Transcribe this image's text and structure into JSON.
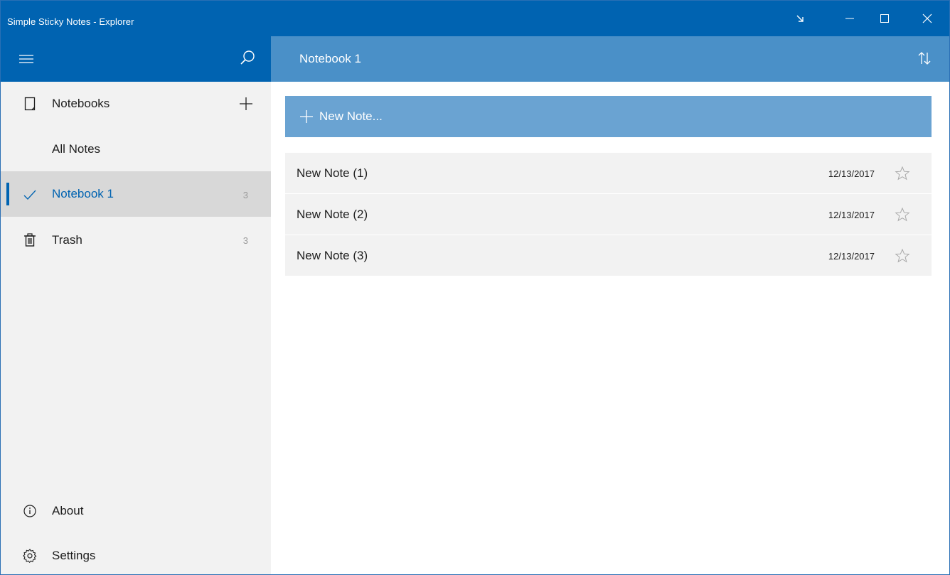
{
  "window": {
    "title": "Simple Sticky Notes - Explorer"
  },
  "header": {
    "title": "Notebook 1"
  },
  "sidebar": {
    "items": [
      {
        "label": "Notebooks",
        "icon": "notebook-icon"
      },
      {
        "label": "All Notes"
      },
      {
        "label": "Notebook 1",
        "icon": "checkmark-icon",
        "count": "3",
        "selected": true
      },
      {
        "label": "Trash",
        "icon": "trash-icon",
        "count": "3"
      }
    ],
    "footer": [
      {
        "label": "About",
        "icon": "info-icon"
      },
      {
        "label": "Settings",
        "icon": "gear-icon"
      }
    ]
  },
  "main": {
    "new_note_label": "New Note...",
    "notes": [
      {
        "title": "New Note (1)",
        "date": "12/13/2017",
        "starred": false
      },
      {
        "title": "New Note (2)",
        "date": "12/13/2017",
        "starred": false
      },
      {
        "title": "New Note (3)",
        "date": "12/13/2017",
        "starred": false
      }
    ]
  },
  "colors": {
    "titlebar": "#0063b1",
    "main_header": "#4a90c8",
    "new_note_bar": "#6aa3d2",
    "sidebar_bg": "#f2f2f2",
    "selected_bg": "#d8d8d8",
    "accent": "#0063b1"
  }
}
